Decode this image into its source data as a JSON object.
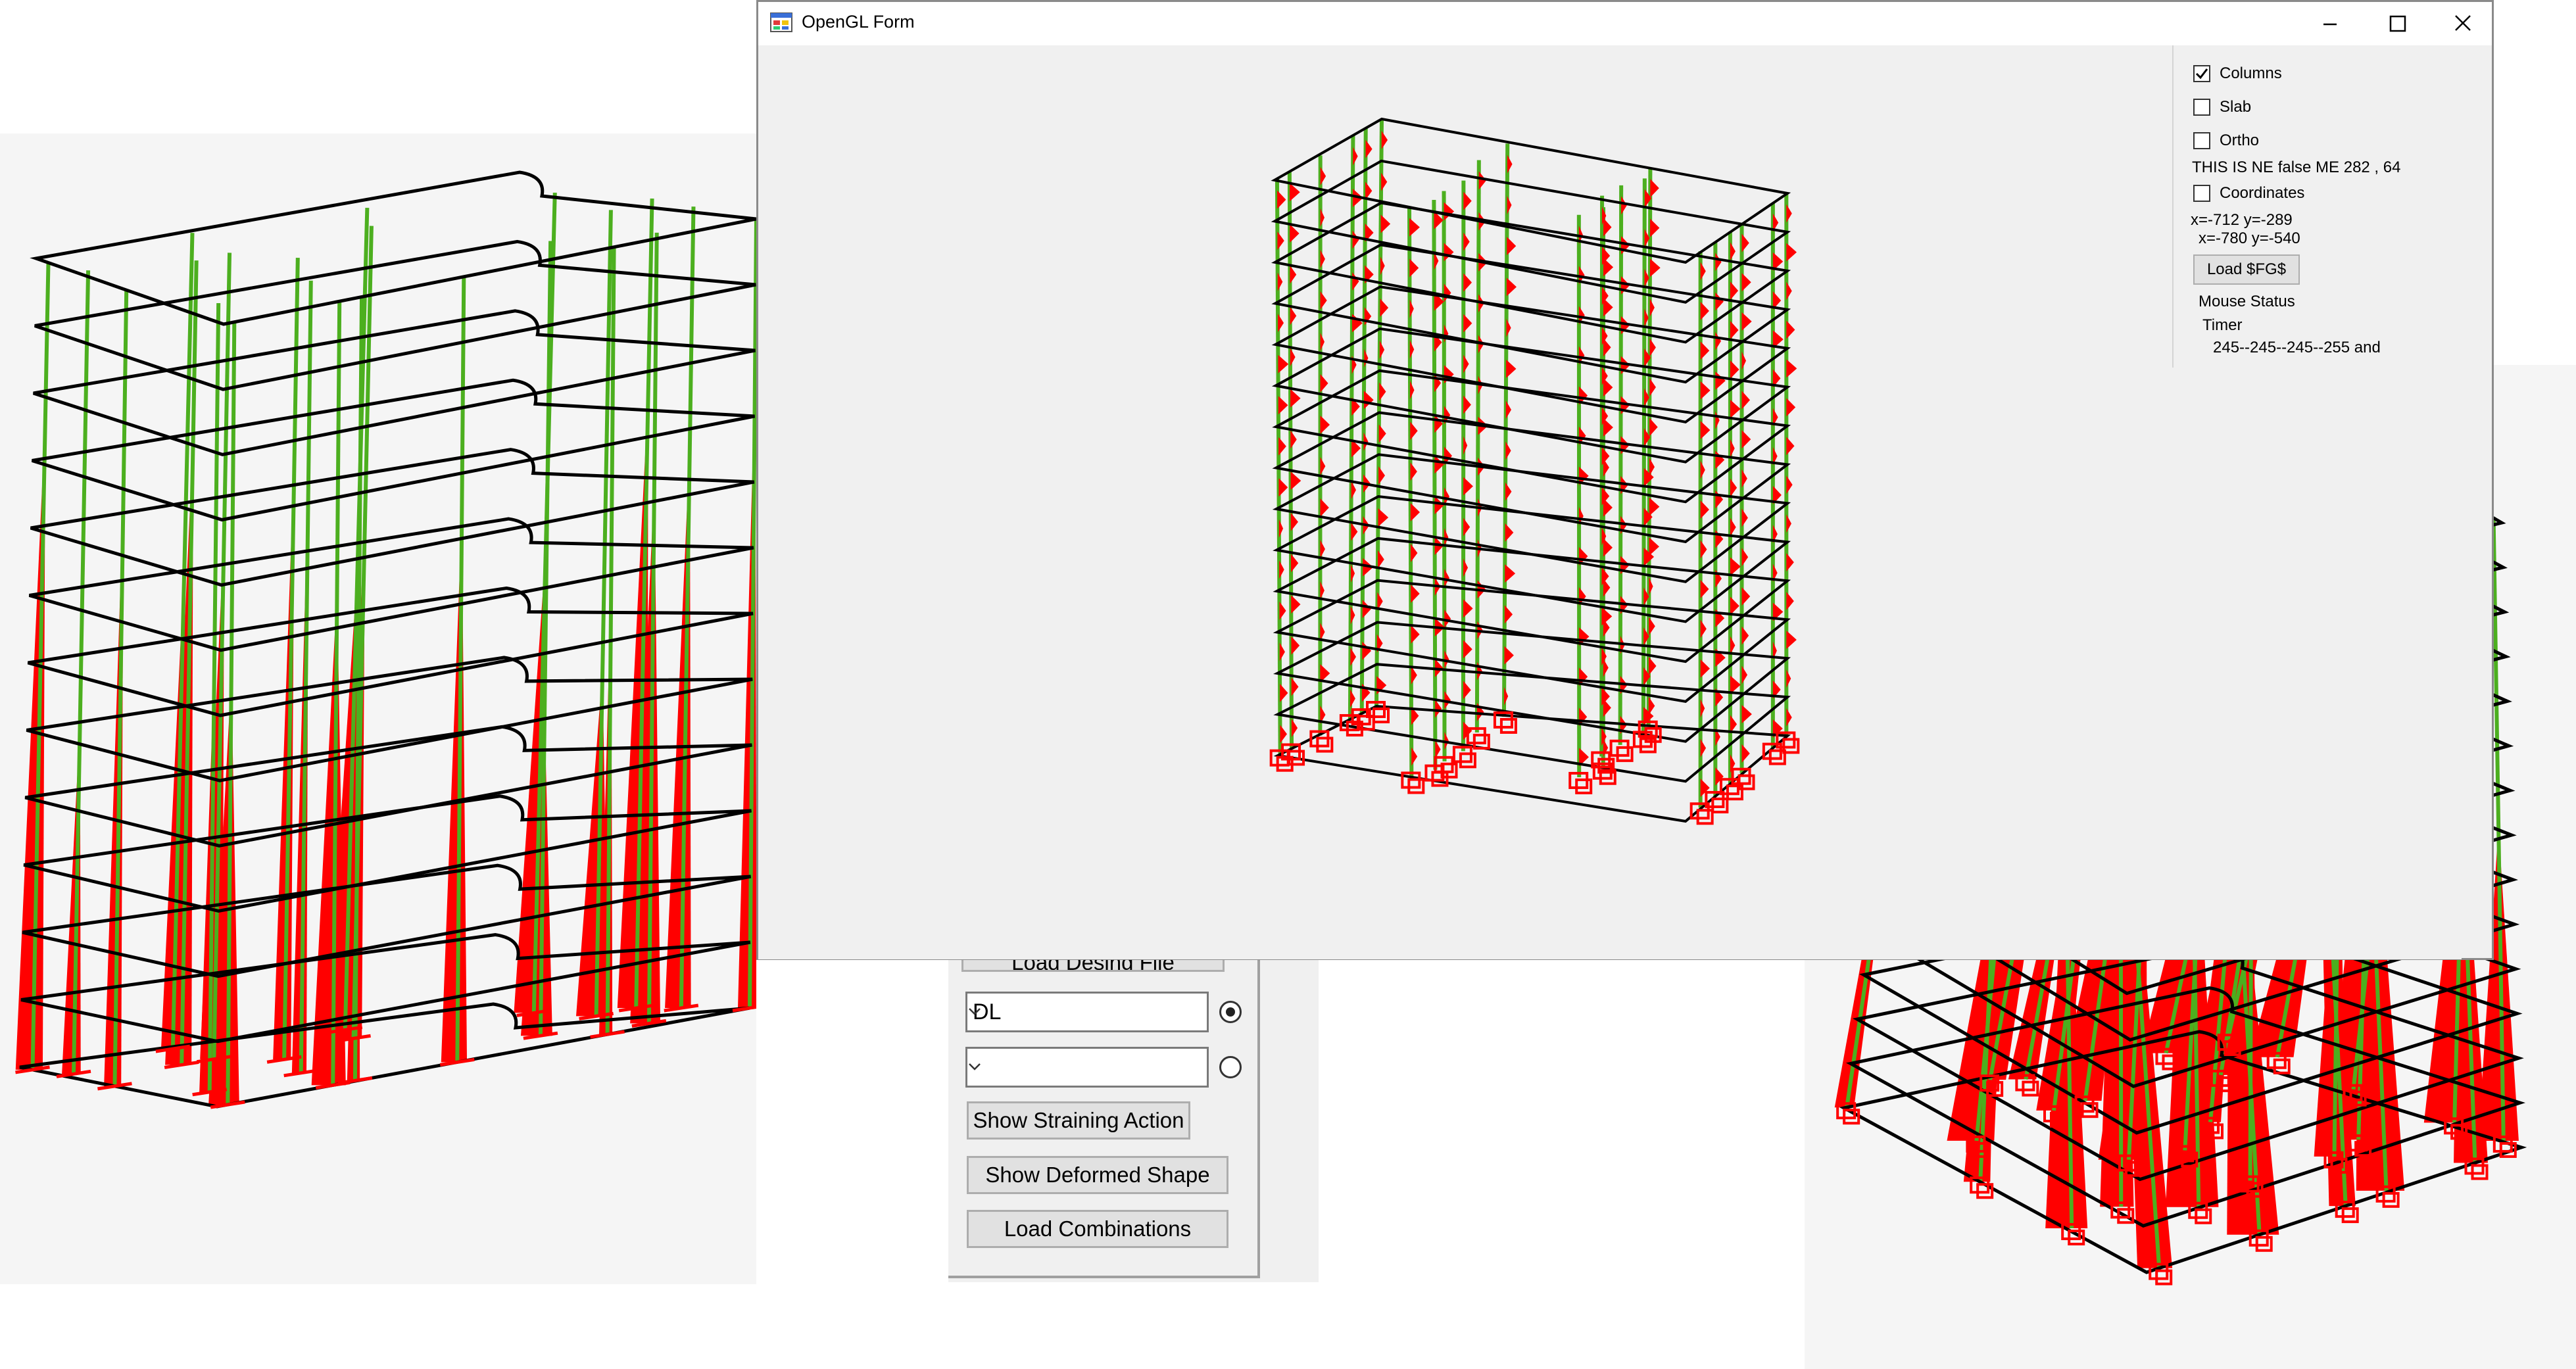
{
  "window": {
    "title": "OpenGL Form",
    "icon": "app-window-icon",
    "controls": [
      "minimize-icon",
      "maximize-icon",
      "close-icon"
    ]
  },
  "options": {
    "columns": {
      "label": "Columns",
      "checked": true
    },
    "slab": {
      "label": "Slab",
      "checked": false
    },
    "ortho": {
      "label": "Ortho",
      "checked": false
    },
    "status_line": "THIS IS NE false   ME   282 , 64",
    "coordinates": {
      "label": "Coordinates",
      "checked": false
    },
    "coord_line_1": "x=-712 y=-289",
    "coord_line_2": "x=-780 y=-540",
    "load_button": "Load $FG$",
    "mouse_status": "Mouse Status",
    "timer": "Timer",
    "color_text": "245--245--245--255 and"
  },
  "controls": {
    "load_design_file": "Load Desing File",
    "combo_1": {
      "value": "DL",
      "selected": true
    },
    "combo_2": {
      "value": "",
      "selected": false
    },
    "show_straining_action": "Show Straining Action",
    "show_deformed_shape": "Show Deformed Shape",
    "load_combinations": "Load Combinations"
  },
  "colors": {
    "column": "#4caf1f",
    "diagram": "#ff0000",
    "slab_outline": "#000000",
    "background": "#f5f5f5"
  },
  "model": {
    "left_view": {
      "floors": 12,
      "diagram": "axial-force"
    },
    "center_view": {
      "floors": 14,
      "diagram": "moment",
      "supports": "fixed"
    },
    "right_view": {
      "floors": 14,
      "diagram": "axial-force",
      "supports": "fixed"
    }
  }
}
